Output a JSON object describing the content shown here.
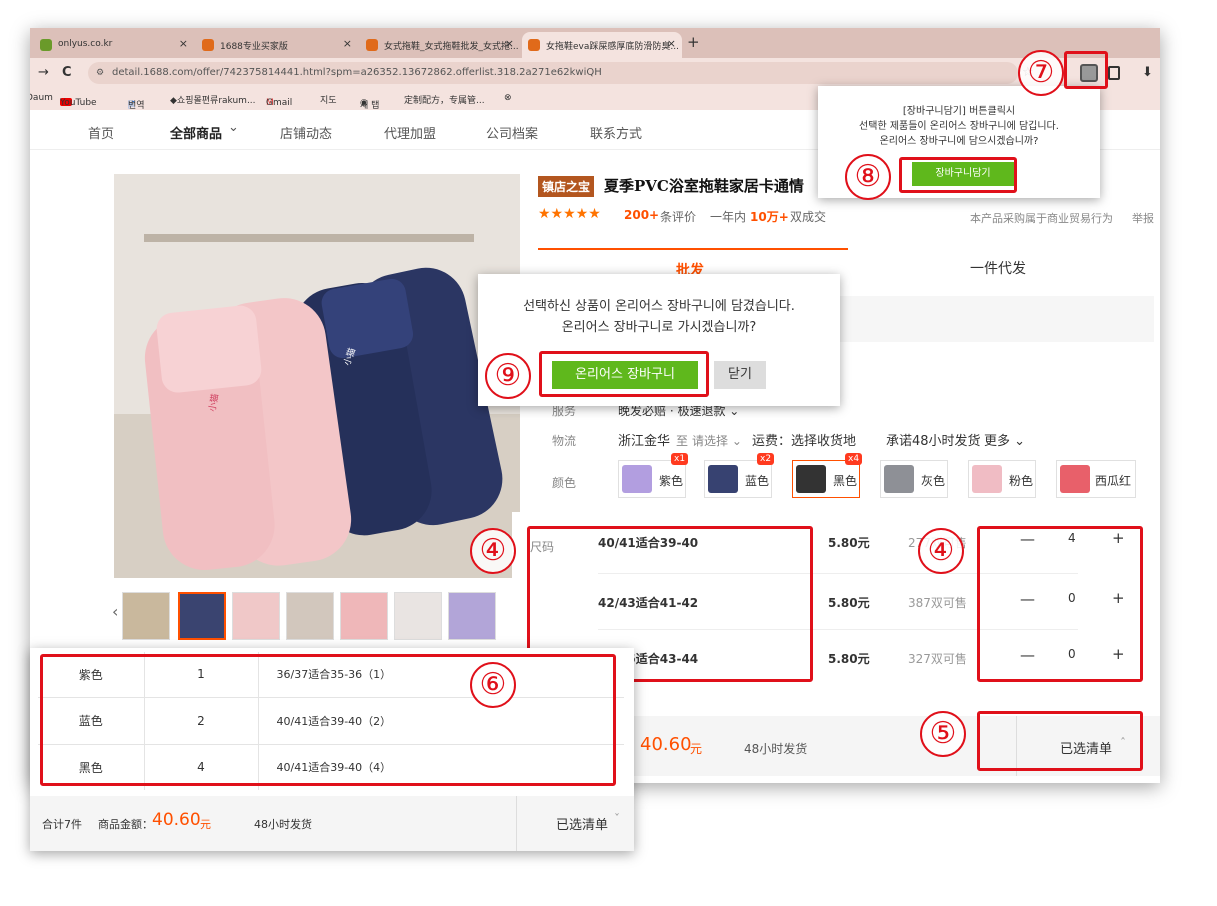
{
  "browser": {
    "tabs": [
      "onlyus.co.kr",
      "1688专业买家版",
      "女式拖鞋_女式拖鞋批发_女式拖...",
      "女拖鞋eva踩屎感厚底防滑防臭..."
    ],
    "url": "detail.1688.com/offer/742375814441.html?spm=a26352.13672862.offerlist.318.2a271e62kwiQH",
    "new_tab_symbol": "+",
    "close_symbol": "×",
    "nav_back": "→",
    "nav_reload": "C",
    "star": "☆",
    "download": "⬇",
    "bookmarks": [
      "Daum",
      "YouTube",
      "번역",
      "◆쇼핑몰편류rakum...",
      "Gmail",
      "지도",
      "새 탭",
      "定制配方，专属管...",
      "⊗"
    ]
  },
  "shop_nav": {
    "items": [
      "首页",
      "全部商品",
      "店铺动态",
      "代理加盟",
      "公司档案",
      "联系方式"
    ],
    "chevron": "⌄"
  },
  "product": {
    "badge": "镇店之宝",
    "title": "夏季PVC浴室拖鞋家居卡通情",
    "stars": "★★★★★",
    "reviews_count": "200+",
    "reviews_label": "条评价",
    "sales_prefix": "一年内",
    "sales_count": "10万+",
    "sales_suffix": "双成交",
    "trade_note": "本产品采购属于商业贸易行为",
    "report": "举报",
    "brand_text": "小猫"
  },
  "tabs": {
    "wholesale": "批发",
    "dropship": "一件代发"
  },
  "options": {
    "service_label": "服务",
    "service_value": "晚发必赔 · 极速退款 ⌄",
    "logistics_label": "物流",
    "logistics_from": "浙江金华",
    "logistics_to": "至",
    "logistics_select": "请选择 ⌄",
    "freight": "运费：选择收货地",
    "promise": "承诺48小时发货",
    "more": "更多 ⌄",
    "color_label": "颜色",
    "size_label": "尺码"
  },
  "colors": [
    {
      "name": "紫色",
      "badge": "x1"
    },
    {
      "name": "蓝色",
      "badge": "x2"
    },
    {
      "name": "黑色",
      "badge": "x4"
    },
    {
      "name": "灰色",
      "badge": ""
    },
    {
      "name": "粉色",
      "badge": ""
    },
    {
      "name": "西瓜红",
      "badge": ""
    }
  ],
  "sizes": [
    {
      "name": "40/41适合39-40",
      "price": "5.80元",
      "stock": "277双可售",
      "qty": "4"
    },
    {
      "name": "42/43适合41-42",
      "price": "5.80元",
      "stock": "387双可售",
      "qty": "0"
    },
    {
      "name": "44/45适合43-44",
      "price": "5.80元",
      "stock": "327双可售",
      "qty": "0"
    }
  ],
  "stepper": {
    "minus": "—",
    "plus": "+"
  },
  "footer": {
    "amount": "40.60",
    "unit": "元",
    "ship": "48小时发货",
    "list": "已选清单",
    "caret": "ˆ"
  },
  "popup_small": {
    "lines": [
      "[장바구니담기] 버튼클릭시",
      "선택한 제품들이 온리어스 장바구니에 담깁니다.",
      "온리어스 장바구니에 담으시겠습니까?"
    ],
    "button": "장바구니담기"
  },
  "popup_main": {
    "lines": [
      "선택하신 상품이 온리어스 장바구니에 담겼습니다.",
      "온리어스 장바구니로 가시겠습니까?"
    ],
    "go": "온리어스 장바구니",
    "close": "닫기"
  },
  "panel": {
    "rows": [
      {
        "color": "紫色",
        "qty": "1",
        "size": "36/37适合35-36（1）"
      },
      {
        "color": "蓝色",
        "qty": "2",
        "size": "40/41适合39-40（2）"
      },
      {
        "color": "黑色",
        "qty": "4",
        "size": "40/41适合39-40（4）"
      }
    ],
    "total_label": "合计7件",
    "amount_label": "商品金额：",
    "amount": "40.60",
    "unit": "元",
    "ship": "48小时发货",
    "list": "已选清单",
    "caret": "ˇ"
  },
  "markers": {
    "m4a": "④",
    "m4b": "④",
    "m5": "⑤",
    "m6": "⑥",
    "m7": "⑦",
    "m8": "⑧",
    "m9": "⑨"
  },
  "colors_theme": {
    "accent": "#e0101a",
    "green": "#5fb81c",
    "orange": "#ff5000",
    "tabbar": "#dcc0b9"
  }
}
